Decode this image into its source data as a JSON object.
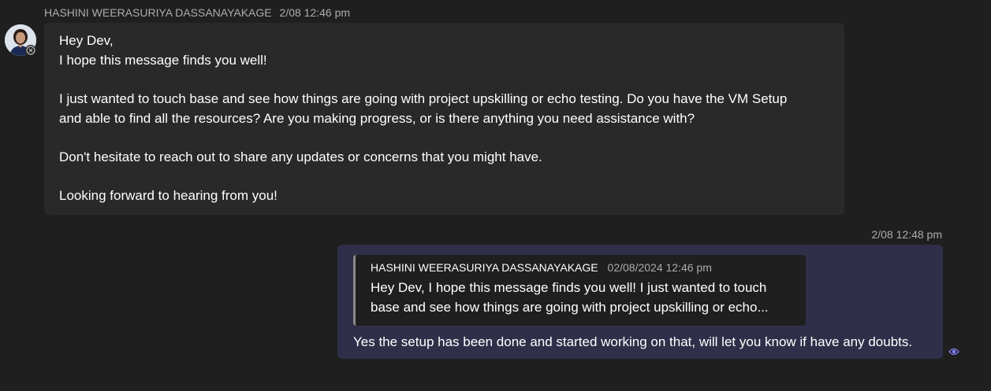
{
  "incoming": {
    "sender": "HASHINI WEERASURIYA DASSANAYAKAGE",
    "timestamp": "2/08 12:46 pm",
    "lines": [
      "Hey Dev,",
      "I hope this message finds you well!",
      "I just wanted to touch base and see how things are going with project upskilling or echo testing. Do you have the VM Setup",
      "and able to find all the resources? Are you making progress, or is there anything you need assistance with?",
      "Don't hesitate to reach out to share any updates or concerns that you might have.",
      "Looking forward to hearing from you!"
    ]
  },
  "outgoing": {
    "timestamp": "2/08 12:48 pm",
    "quote": {
      "sender": "HASHINI WEERASURIYA DASSANAYAKAGE",
      "timestamp": "02/08/2024 12:46 pm",
      "text": "Hey Dev, I hope this message finds you well!   I just wanted to touch base and see how things are going with project upskilling or echo..."
    },
    "reply": "Yes the setup has been done and started working on that, will let you know if have any doubts."
  },
  "icons": {
    "avatar": "profile-photo",
    "presence": "offline-status-icon",
    "read_receipt": "seen-eye-icon"
  },
  "colors": {
    "background": "#1f1f1f",
    "incoming_bubble": "#292929",
    "outgoing_bubble": "#2f2f4a",
    "accent": "#7f85f5"
  }
}
